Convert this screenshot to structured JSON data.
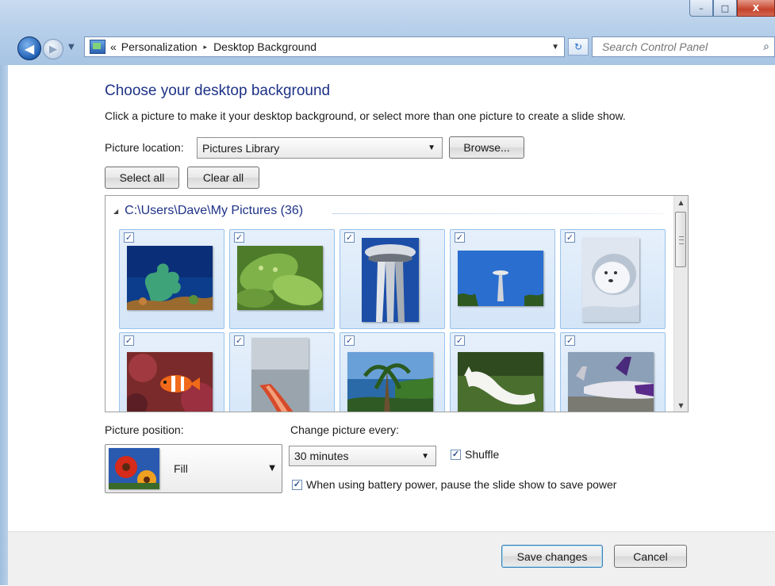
{
  "window": {
    "controls": {
      "minimize": "–",
      "maximize": "□",
      "close": "X"
    }
  },
  "nav": {
    "back_icon": "arrow-left-icon",
    "forward_icon": "arrow-right-icon",
    "breadcrumb_overflow": "«",
    "breadcrumbs": [
      "Personalization",
      "Desktop Background"
    ],
    "breadcrumb_separator": "▸",
    "refresh_icon": "↻",
    "search_placeholder": "Search Control Panel"
  },
  "main": {
    "title": "Choose your desktop background",
    "description": "Click a picture to make it your desktop background, or select more than one picture to create a slide show.",
    "picture_location_label": "Picture location:",
    "picture_location_value": "Pictures Library",
    "browse_label": "Browse...",
    "select_all_label": "Select all",
    "clear_all_label": "Clear all"
  },
  "gallery": {
    "group_title": "C:\\Users\\Dave\\My Pictures (36)",
    "items": [
      {
        "name": "underwater-seaweed",
        "checked": true
      },
      {
        "name": "green-leaves",
        "checked": true
      },
      {
        "name": "space-needle-closeup",
        "checked": true
      },
      {
        "name": "space-needle-sky",
        "checked": true
      },
      {
        "name": "white-dog-snow",
        "checked": true
      },
      {
        "name": "clownfish",
        "checked": true
      },
      {
        "name": "red-kayak",
        "checked": true
      },
      {
        "name": "palm-tree-coast",
        "checked": true
      },
      {
        "name": "white-dog-stretching",
        "checked": true
      },
      {
        "name": "airplanes-tarmac",
        "checked": true
      }
    ]
  },
  "position": {
    "label": "Picture position:",
    "value": "Fill"
  },
  "interval": {
    "label": "Change picture every:",
    "value": "30 minutes",
    "shuffle_label": "Shuffle",
    "shuffle_checked": true,
    "battery_label": "When using battery power, pause the slide show to save power",
    "battery_checked": true
  },
  "footer": {
    "save_label": "Save changes",
    "cancel_label": "Cancel"
  }
}
